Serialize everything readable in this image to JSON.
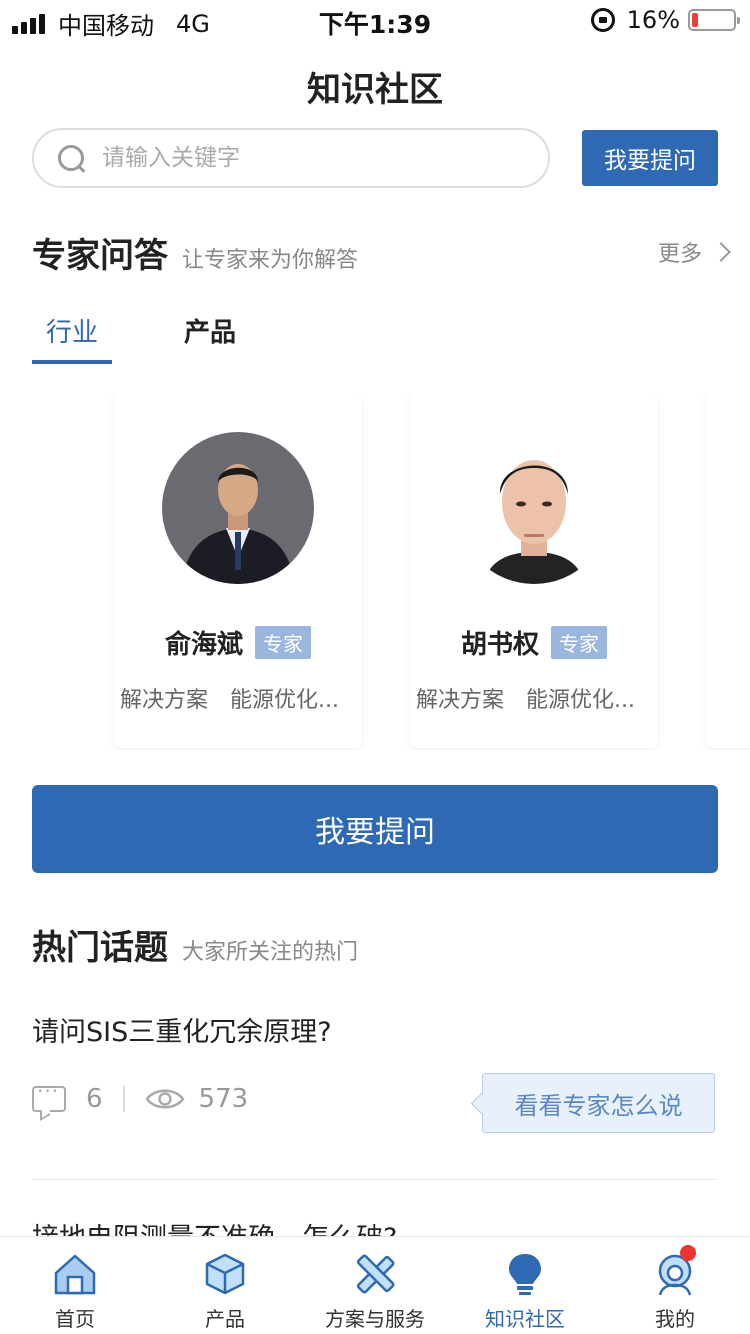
{
  "status_bar": {
    "carrier": "中国移动",
    "network": "4G",
    "time": "下午1:39",
    "battery_text": "16%",
    "battery_level": 0.16
  },
  "header": {
    "title": "知识社区"
  },
  "search": {
    "placeholder": "请输入关键字",
    "ask_label": "我要提问"
  },
  "experts": {
    "title": "专家问答",
    "subtitle": "让专家来为你解答",
    "more_label": "更多",
    "tabs": [
      {
        "label": "行业"
      },
      {
        "label": "产品"
      }
    ],
    "cards": [
      {
        "name": "俞海斌",
        "badge": "专家",
        "tags": [
          "解决方案",
          "能源优化..."
        ]
      },
      {
        "name": "胡书权",
        "badge": "专家",
        "tags": [
          "解决方案",
          "能源优化..."
        ]
      }
    ],
    "ask_button_label": "我要提问"
  },
  "hot_topics": {
    "title": "热门话题",
    "subtitle": "大家所关注的热门",
    "items": [
      {
        "title": "请问SIS三重化冗余原理?",
        "comments": "6",
        "views": "573",
        "action_label": "看看专家怎么说"
      },
      {
        "title": "接地电阻测量不准确，怎么破?"
      }
    ]
  },
  "tab_bar": {
    "items": [
      {
        "label": "首页"
      },
      {
        "label": "产品"
      },
      {
        "label": "方案与服务"
      },
      {
        "label": "知识社区"
      },
      {
        "label": "我的"
      }
    ]
  },
  "colors": {
    "primary": "#2f69b3",
    "badge": "#9ab6dc",
    "notification": "#e33333",
    "battery_low": "#e8413a"
  }
}
